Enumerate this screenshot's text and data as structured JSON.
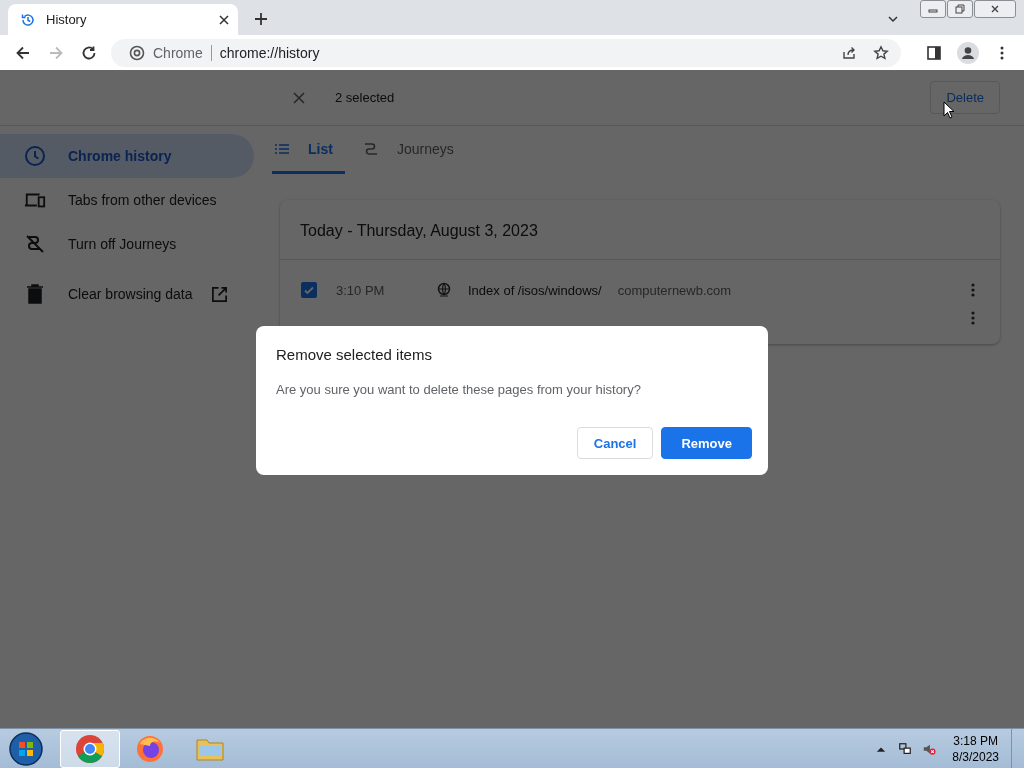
{
  "browser": {
    "tabs": [
      {
        "title": "History",
        "selected": true
      }
    ],
    "toolbar": {
      "back_disabled": false,
      "forward_disabled": true,
      "site_label": "Chrome",
      "url": "chrome://history"
    }
  },
  "selection_bar": {
    "count": "2 selected",
    "action": "Delete"
  },
  "sidebar": {
    "items": [
      {
        "label": "Chrome history",
        "selected": true,
        "external": false
      },
      {
        "label": "Tabs from other devices",
        "selected": false,
        "external": false
      },
      {
        "label": "Turn off Journeys",
        "selected": false,
        "external": false
      },
      {
        "label": "Clear browsing data",
        "selected": false,
        "external": true
      }
    ]
  },
  "view_tabs": [
    {
      "label": "List",
      "selected": true
    },
    {
      "label": "Journeys",
      "selected": false
    }
  ],
  "history_card": {
    "date": "Today - Thursday, August 3, 2023",
    "rows": [
      {
        "kind": "entry",
        "checked": true,
        "time": "3:10 PM",
        "title": "Index of /isos/windows/",
        "domain": "computernewb.com"
      },
      {
        "kind": "covered"
      }
    ]
  },
  "dialog": {
    "title": "Remove selected items",
    "message": "Are you sure you want to delete these pages from your history?",
    "buttons": [
      {
        "label": "Cancel",
        "kind": "secondary"
      },
      {
        "label": "Remove",
        "kind": "primary"
      }
    ]
  },
  "taskbar": {
    "apps": [
      {
        "kind": "chrome",
        "selected": true
      },
      {
        "kind": "firefox",
        "selected": false
      },
      {
        "kind": "folder",
        "selected": false
      }
    ],
    "time": "3:18 PM",
    "date": "8/3/2023"
  }
}
